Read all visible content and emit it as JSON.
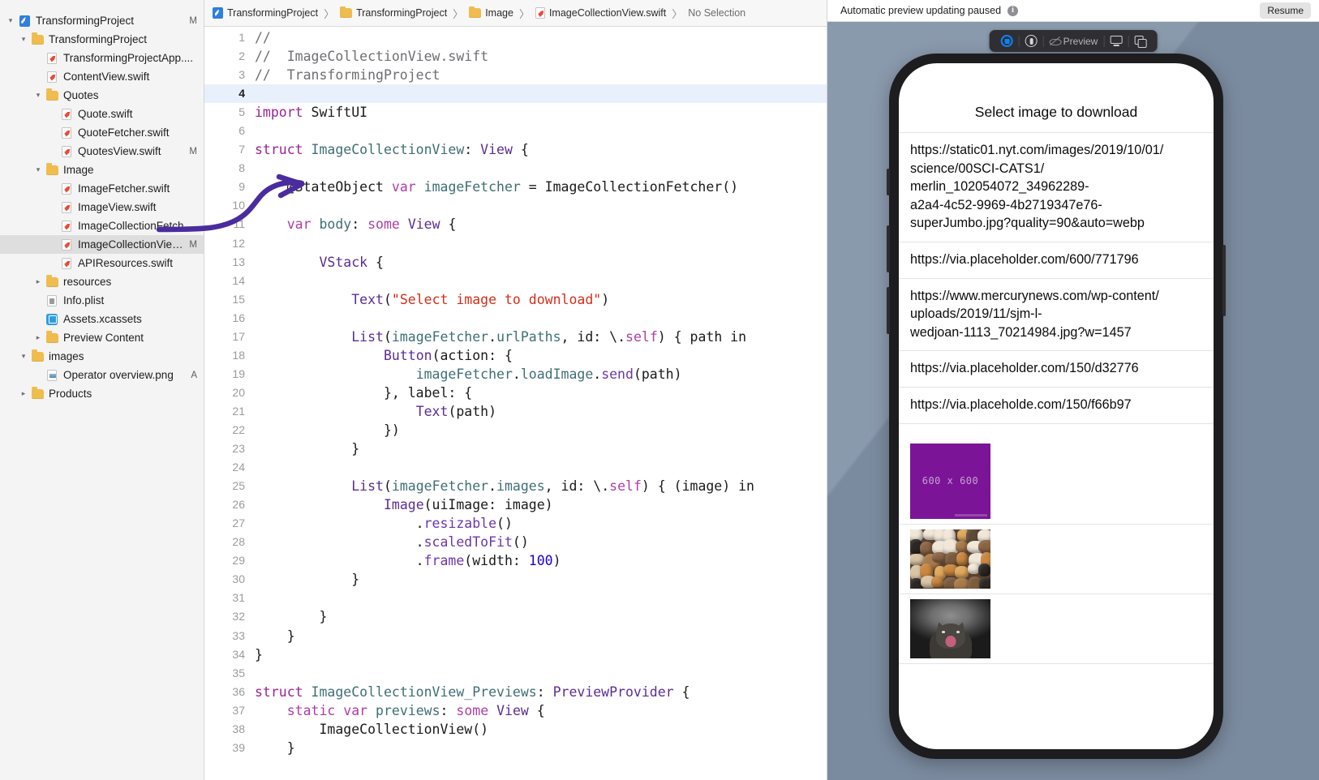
{
  "navigator": {
    "items": [
      {
        "indent": 0,
        "twisty": "open",
        "icon": "xcode-project-icon",
        "label": "TransformingProject",
        "badge": "M"
      },
      {
        "indent": 1,
        "twisty": "open",
        "icon": "folder-icon",
        "label": "TransformingProject",
        "badge": ""
      },
      {
        "indent": 2,
        "twisty": "none",
        "icon": "swift-file-icon",
        "label": "TransformingProjectApp....",
        "badge": ""
      },
      {
        "indent": 2,
        "twisty": "none",
        "icon": "swift-file-icon",
        "label": "ContentView.swift",
        "badge": ""
      },
      {
        "indent": 2,
        "twisty": "open",
        "icon": "folder-icon",
        "label": "Quotes",
        "badge": ""
      },
      {
        "indent": 3,
        "twisty": "none",
        "icon": "swift-file-icon",
        "label": "Quote.swift",
        "badge": ""
      },
      {
        "indent": 3,
        "twisty": "none",
        "icon": "swift-file-icon",
        "label": "QuoteFetcher.swift",
        "badge": ""
      },
      {
        "indent": 3,
        "twisty": "none",
        "icon": "swift-file-icon",
        "label": "QuotesView.swift",
        "badge": "M"
      },
      {
        "indent": 2,
        "twisty": "open",
        "icon": "folder-icon",
        "label": "Image",
        "badge": ""
      },
      {
        "indent": 3,
        "twisty": "none",
        "icon": "swift-file-icon",
        "label": "ImageFetcher.swift",
        "badge": ""
      },
      {
        "indent": 3,
        "twisty": "none",
        "icon": "swift-file-icon",
        "label": "ImageView.swift",
        "badge": ""
      },
      {
        "indent": 3,
        "twisty": "none",
        "icon": "swift-file-icon",
        "label": "ImageCollectionFetcher...",
        "badge": ""
      },
      {
        "indent": 3,
        "twisty": "none",
        "icon": "swift-file-icon",
        "label": "ImageCollectionView...",
        "badge": "M",
        "selected": true
      },
      {
        "indent": 3,
        "twisty": "none",
        "icon": "swift-file-icon",
        "label": "APIResources.swift",
        "badge": ""
      },
      {
        "indent": 2,
        "twisty": "closed",
        "icon": "folder-icon",
        "label": "resources",
        "badge": ""
      },
      {
        "indent": 2,
        "twisty": "none",
        "icon": "plist-file-icon",
        "label": "Info.plist",
        "badge": ""
      },
      {
        "indent": 2,
        "twisty": "none",
        "icon": "assets-catalog-icon",
        "label": "Assets.xcassets",
        "badge": ""
      },
      {
        "indent": 2,
        "twisty": "closed",
        "icon": "folder-icon",
        "label": "Preview Content",
        "badge": ""
      },
      {
        "indent": 1,
        "twisty": "open",
        "icon": "folder-icon",
        "label": "images",
        "badge": ""
      },
      {
        "indent": 2,
        "twisty": "none",
        "icon": "png-file-icon",
        "label": "Operator overview.png",
        "badge": "A"
      },
      {
        "indent": 1,
        "twisty": "closed",
        "icon": "folder-icon",
        "label": "Products",
        "badge": ""
      }
    ]
  },
  "jumpbar": {
    "crumbs": [
      {
        "icon": "xcode-project-icon",
        "label": "TransformingProject"
      },
      {
        "icon": "folder-icon",
        "label": "TransformingProject"
      },
      {
        "icon": "folder-icon",
        "label": "Image"
      },
      {
        "icon": "swift-file-icon",
        "label": "ImageCollectionView.swift"
      },
      {
        "icon": "none",
        "label": "No Selection"
      }
    ]
  },
  "editor": {
    "highlighted_line": 4,
    "lines": [
      {
        "n": 1,
        "tokens": [
          {
            "t": "//",
            "c": "c-cmt"
          }
        ]
      },
      {
        "n": 2,
        "tokens": [
          {
            "t": "//  ImageCollectionView.swift",
            "c": "c-cmt"
          }
        ]
      },
      {
        "n": 3,
        "tokens": [
          {
            "t": "//  TransformingProject",
            "c": "c-cmt"
          }
        ]
      },
      {
        "n": 4,
        "tokens": [
          {
            "t": "",
            "c": "c-plain"
          }
        ]
      },
      {
        "n": 5,
        "tokens": [
          {
            "t": "import",
            "c": "c-kw"
          },
          {
            "t": " SwiftUI",
            "c": "c-plain"
          }
        ]
      },
      {
        "n": 6,
        "tokens": [
          {
            "t": "",
            "c": "c-plain"
          }
        ]
      },
      {
        "n": 7,
        "tokens": [
          {
            "t": "struct",
            "c": "c-kw"
          },
          {
            "t": " ",
            "c": "c-plain"
          },
          {
            "t": "ImageCollectionView",
            "c": "c-type"
          },
          {
            "t": ": ",
            "c": "c-plain"
          },
          {
            "t": "View",
            "c": "c-typeP"
          },
          {
            "t": " {",
            "c": "c-plain"
          }
        ]
      },
      {
        "n": 8,
        "tokens": [
          {
            "t": "",
            "c": "c-plain"
          }
        ]
      },
      {
        "n": 9,
        "tokens": [
          {
            "t": "    @StateObject ",
            "c": "c-attr"
          },
          {
            "t": "var",
            "c": "c-kw2"
          },
          {
            "t": " ",
            "c": "c-plain"
          },
          {
            "t": "imageFetcher",
            "c": "c-prop"
          },
          {
            "t": " = ",
            "c": "c-plain"
          },
          {
            "t": "ImageCollectionFetcher",
            "c": "c-plain"
          },
          {
            "t": "()",
            "c": "c-plain"
          }
        ]
      },
      {
        "n": 10,
        "tokens": [
          {
            "t": "",
            "c": "c-plain"
          }
        ]
      },
      {
        "n": 11,
        "tokens": [
          {
            "t": "    ",
            "c": "c-plain"
          },
          {
            "t": "var",
            "c": "c-kw2"
          },
          {
            "t": " ",
            "c": "c-plain"
          },
          {
            "t": "body",
            "c": "c-prop"
          },
          {
            "t": ": ",
            "c": "c-plain"
          },
          {
            "t": "some",
            "c": "c-kw2"
          },
          {
            "t": " ",
            "c": "c-plain"
          },
          {
            "t": "View",
            "c": "c-typeP"
          },
          {
            "t": " {",
            "c": "c-plain"
          }
        ]
      },
      {
        "n": 12,
        "tokens": [
          {
            "t": "",
            "c": "c-plain"
          }
        ]
      },
      {
        "n": 13,
        "tokens": [
          {
            "t": "        ",
            "c": "c-plain"
          },
          {
            "t": "VStack",
            "c": "c-typeP"
          },
          {
            "t": " {",
            "c": "c-plain"
          }
        ]
      },
      {
        "n": 14,
        "tokens": [
          {
            "t": "",
            "c": "c-plain"
          }
        ]
      },
      {
        "n": 15,
        "tokens": [
          {
            "t": "            ",
            "c": "c-plain"
          },
          {
            "t": "Text",
            "c": "c-typeP"
          },
          {
            "t": "(",
            "c": "c-plain"
          },
          {
            "t": "\"Select image to download\"",
            "c": "c-str"
          },
          {
            "t": ")",
            "c": "c-plain"
          }
        ]
      },
      {
        "n": 16,
        "tokens": [
          {
            "t": "",
            "c": "c-plain"
          }
        ]
      },
      {
        "n": 17,
        "tokens": [
          {
            "t": "            ",
            "c": "c-plain"
          },
          {
            "t": "List",
            "c": "c-typeP"
          },
          {
            "t": "(",
            "c": "c-plain"
          },
          {
            "t": "imageFetcher",
            "c": "c-prop"
          },
          {
            "t": ".",
            "c": "c-plain"
          },
          {
            "t": "urlPaths",
            "c": "c-prop"
          },
          {
            "t": ", id: \\.",
            "c": "c-plain"
          },
          {
            "t": "self",
            "c": "c-kw2"
          },
          {
            "t": ") { path in",
            "c": "c-plain"
          }
        ]
      },
      {
        "n": 18,
        "tokens": [
          {
            "t": "                ",
            "c": "c-plain"
          },
          {
            "t": "Button",
            "c": "c-typeP"
          },
          {
            "t": "(action: {",
            "c": "c-plain"
          }
        ]
      },
      {
        "n": 19,
        "tokens": [
          {
            "t": "                    ",
            "c": "c-plain"
          },
          {
            "t": "imageFetcher",
            "c": "c-prop"
          },
          {
            "t": ".",
            "c": "c-plain"
          },
          {
            "t": "loadImage",
            "c": "c-prop"
          },
          {
            "t": ".",
            "c": "c-plain"
          },
          {
            "t": "send",
            "c": "c-meth"
          },
          {
            "t": "(path)",
            "c": "c-plain"
          }
        ]
      },
      {
        "n": 20,
        "tokens": [
          {
            "t": "                }, label: {",
            "c": "c-plain"
          }
        ]
      },
      {
        "n": 21,
        "tokens": [
          {
            "t": "                    ",
            "c": "c-plain"
          },
          {
            "t": "Text",
            "c": "c-typeP"
          },
          {
            "t": "(path)",
            "c": "c-plain"
          }
        ]
      },
      {
        "n": 22,
        "tokens": [
          {
            "t": "                })",
            "c": "c-plain"
          }
        ]
      },
      {
        "n": 23,
        "tokens": [
          {
            "t": "            }",
            "c": "c-plain"
          }
        ]
      },
      {
        "n": 24,
        "tokens": [
          {
            "t": "",
            "c": "c-plain"
          }
        ]
      },
      {
        "n": 25,
        "tokens": [
          {
            "t": "            ",
            "c": "c-plain"
          },
          {
            "t": "List",
            "c": "c-typeP"
          },
          {
            "t": "(",
            "c": "c-plain"
          },
          {
            "t": "imageFetcher",
            "c": "c-prop"
          },
          {
            "t": ".",
            "c": "c-plain"
          },
          {
            "t": "images",
            "c": "c-prop"
          },
          {
            "t": ", id: \\.",
            "c": "c-plain"
          },
          {
            "t": "self",
            "c": "c-kw2"
          },
          {
            "t": ") { (image) in",
            "c": "c-plain"
          }
        ]
      },
      {
        "n": 26,
        "tokens": [
          {
            "t": "                ",
            "c": "c-plain"
          },
          {
            "t": "Image",
            "c": "c-typeP"
          },
          {
            "t": "(uiImage: image)",
            "c": "c-plain"
          }
        ]
      },
      {
        "n": 27,
        "tokens": [
          {
            "t": "                    .",
            "c": "c-plain"
          },
          {
            "t": "resizable",
            "c": "c-meth"
          },
          {
            "t": "()",
            "c": "c-plain"
          }
        ]
      },
      {
        "n": 28,
        "tokens": [
          {
            "t": "                    .",
            "c": "c-plain"
          },
          {
            "t": "scaledToFit",
            "c": "c-meth"
          },
          {
            "t": "()",
            "c": "c-plain"
          }
        ]
      },
      {
        "n": 29,
        "tokens": [
          {
            "t": "                    .",
            "c": "c-plain"
          },
          {
            "t": "frame",
            "c": "c-meth"
          },
          {
            "t": "(width: ",
            "c": "c-plain"
          },
          {
            "t": "100",
            "c": "c-num"
          },
          {
            "t": ")",
            "c": "c-plain"
          }
        ]
      },
      {
        "n": 30,
        "tokens": [
          {
            "t": "            }",
            "c": "c-plain"
          }
        ]
      },
      {
        "n": 31,
        "tokens": [
          {
            "t": "",
            "c": "c-plain"
          }
        ]
      },
      {
        "n": 32,
        "tokens": [
          {
            "t": "        }",
            "c": "c-plain"
          }
        ]
      },
      {
        "n": 33,
        "tokens": [
          {
            "t": "    }",
            "c": "c-plain"
          }
        ]
      },
      {
        "n": 34,
        "tokens": [
          {
            "t": "}",
            "c": "c-plain"
          }
        ]
      },
      {
        "n": 35,
        "tokens": [
          {
            "t": "",
            "c": "c-plain"
          }
        ]
      },
      {
        "n": 36,
        "tokens": [
          {
            "t": "struct",
            "c": "c-kw"
          },
          {
            "t": " ",
            "c": "c-plain"
          },
          {
            "t": "ImageCollectionView_Previews",
            "c": "c-type"
          },
          {
            "t": ": ",
            "c": "c-plain"
          },
          {
            "t": "PreviewProvider",
            "c": "c-typeP"
          },
          {
            "t": " {",
            "c": "c-plain"
          }
        ]
      },
      {
        "n": 37,
        "tokens": [
          {
            "t": "    ",
            "c": "c-plain"
          },
          {
            "t": "static var",
            "c": "c-kw2"
          },
          {
            "t": " ",
            "c": "c-plain"
          },
          {
            "t": "previews",
            "c": "c-prop"
          },
          {
            "t": ": ",
            "c": "c-plain"
          },
          {
            "t": "some",
            "c": "c-kw2"
          },
          {
            "t": " ",
            "c": "c-plain"
          },
          {
            "t": "View",
            "c": "c-typeP"
          },
          {
            "t": " {",
            "c": "c-plain"
          }
        ]
      },
      {
        "n": 38,
        "tokens": [
          {
            "t": "        ",
            "c": "c-plain"
          },
          {
            "t": "ImageCollectionView",
            "c": "c-plain"
          },
          {
            "t": "()",
            "c": "c-plain"
          }
        ]
      },
      {
        "n": 39,
        "tokens": [
          {
            "t": "    }",
            "c": "c-plain"
          }
        ]
      }
    ]
  },
  "preview": {
    "status_text": "Automatic preview updating paused",
    "info_icon": "info-circle-icon",
    "resume_label": "Resume",
    "toolbar": {
      "items": [
        {
          "icon": "device-select-icon",
          "label": ""
        },
        {
          "icon": "inspect-device-icon",
          "label": ""
        },
        {
          "icon": "eye-slash-icon",
          "label": "Preview"
        },
        {
          "icon": "monitor-icon",
          "label": ""
        },
        {
          "icon": "duplicate-icon",
          "label": ""
        }
      ]
    },
    "canvas_bg": "#7f90a5"
  },
  "app_preview": {
    "title": "Select image to download",
    "urls": [
      "https://static01.nyt.com/images/2019/10/01/\nscience/00SCI-CATS1/\nmerlin_102054072_34962289-\na2a4-4c52-9969-4b2719347e76-\nsuperJumbo.jpg?quality=90&auto=webp",
      "https://via.placeholder.com/600/771796",
      "https://www.mercurynews.com/wp-content/\nuploads/2019/11/sjm-l-\nwedjoan-1113_70214984.jpg?w=1457",
      "https://via.placeholder.com/150/d32776",
      "https://via.placeholde.com/150/f66b97"
    ],
    "images": [
      {
        "kind": "placeholder",
        "label": "600 x 600",
        "color": "#7b1497"
      },
      {
        "kind": "photo-many-cats",
        "label": ""
      },
      {
        "kind": "photo-yawning-cat",
        "label": ""
      }
    ]
  },
  "annotation": {
    "color": "#4b2c9e",
    "shape": "curved-arrow-pointing-to-stateobject"
  }
}
